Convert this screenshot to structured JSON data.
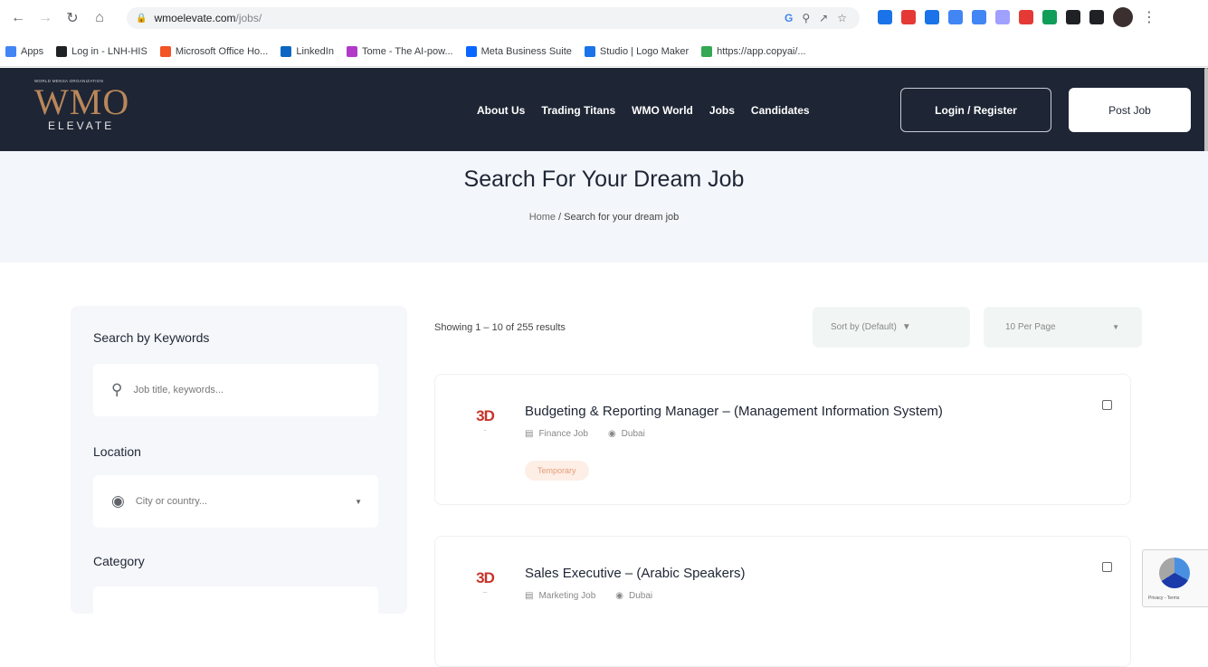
{
  "browser": {
    "url_host": "wmoelevate.com",
    "url_path": "/jobs/",
    "bookmarks": [
      {
        "label": "Apps",
        "color": "#4285f4"
      },
      {
        "label": "Log in - LNH-HIS",
        "color": "#202124"
      },
      {
        "label": "Microsoft Office Ho...",
        "color": "#f35325"
      },
      {
        "label": "LinkedIn",
        "color": "#0a66c2"
      },
      {
        "label": "Tome - The AI-pow...",
        "color": "#b23ac9"
      },
      {
        "label": "Meta Business Suite",
        "color": "#0866ff"
      },
      {
        "label": "Studio | Logo Maker",
        "color": "#1a73e8"
      },
      {
        "label": "https://app.copyai/...",
        "color": "#34a853"
      }
    ],
    "extension_colors": [
      "#1a73e8",
      "#e53935",
      "#1a73e8",
      "#4285f4",
      "#4285f4",
      "#a0a0ff",
      "#e53935",
      "#0f9d58",
      "#202124",
      "#202124"
    ]
  },
  "site": {
    "logo_org_text": "WORLD MENSA ORGANIZATION",
    "logo_wmo": "WMO",
    "logo_elevate": "ELEVATE",
    "nav": [
      "About Us",
      "Trading Titans",
      "WMO World",
      "Jobs",
      "Candidates"
    ],
    "login_label": "Login / Register",
    "post_job_label": "Post Job"
  },
  "hero": {
    "title": "Search For Your Dream Job",
    "breadcrumb_home": "Home",
    "breadcrumb_current": "Search for your dream job"
  },
  "sidebar": {
    "keywords_label": "Search by Keywords",
    "keywords_placeholder": "Job title, keywords...",
    "location_label": "Location",
    "location_placeholder": "City or country...",
    "category_label": "Category"
  },
  "results": {
    "count_text": "Showing 1 – 10 of 255 results",
    "sort_label": "Sort by (Default)",
    "per_page_label": "10 Per Page"
  },
  "jobs": [
    {
      "title": "Budgeting & Reporting Manager – (Management Information System)",
      "category": "Finance Job",
      "location": "Dubai",
      "tag": "Temporary",
      "company_mark": "3D",
      "company_sub": "_"
    },
    {
      "title": "Sales Executive – (Arabic Speakers)",
      "category": "Marketing Job",
      "location": "Dubai",
      "company_mark": "3D",
      "company_sub": "__"
    }
  ],
  "recaptcha_text": "Privacy - Terms"
}
